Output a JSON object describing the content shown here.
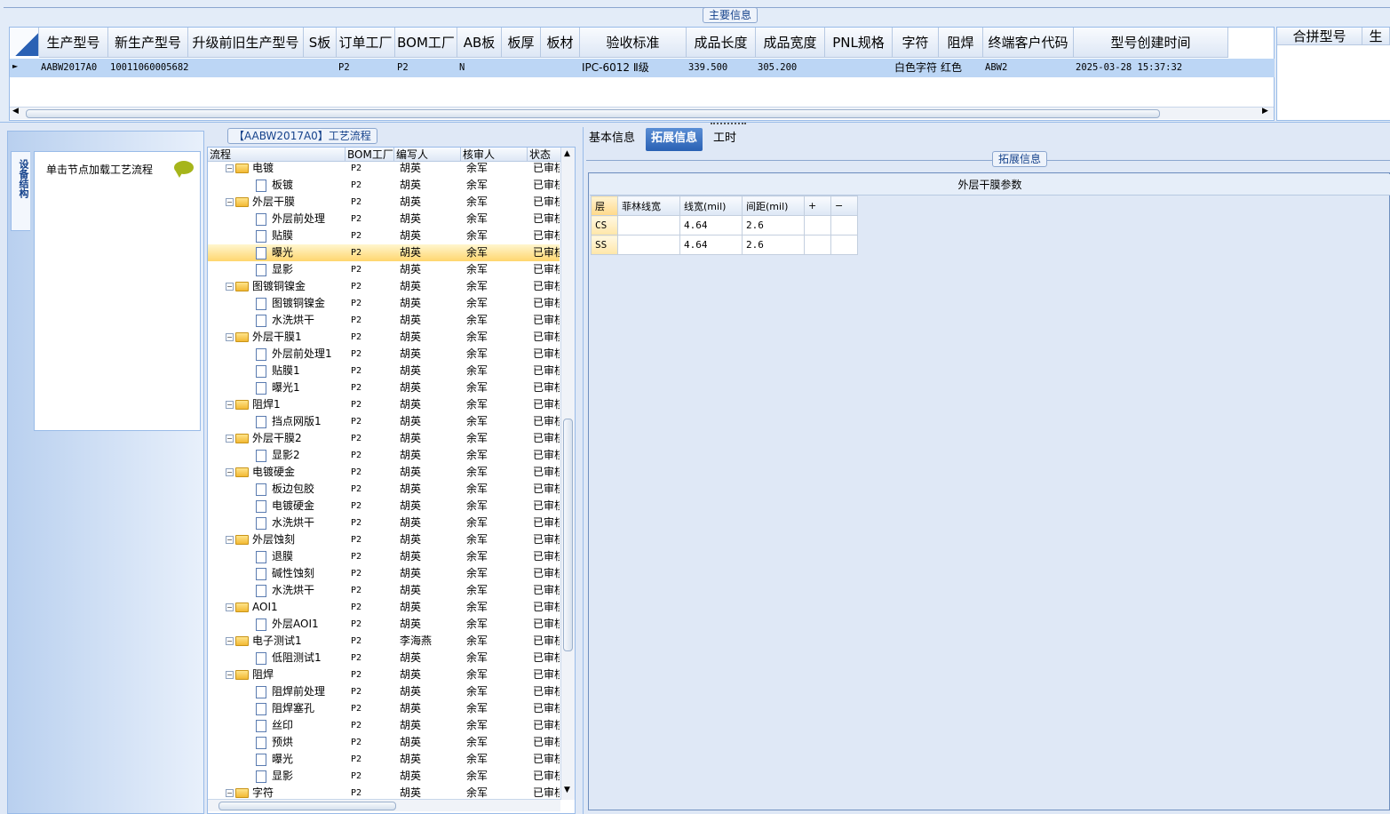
{
  "top": {
    "group_title": "主要信息",
    "columns": [
      "生产型号",
      "新生产型号",
      "升级前旧生产型号",
      "S板",
      "订单工厂",
      "BOM工厂",
      "AB板",
      "板厚",
      "板材",
      "验收标准",
      "成品长度",
      "成品宽度",
      "PNL规格",
      "字符",
      "阻焊",
      "终端客户代码",
      "型号创建时间"
    ],
    "row": [
      "AABW2017A0",
      "10011060005682",
      "",
      "",
      "P2",
      "P2",
      "N",
      "",
      "",
      "IPC-6012 Ⅱ级",
      "339.500",
      "305.200",
      "",
      "白色字符",
      "红色",
      "ABW2",
      "2025-03-28 15:37:32"
    ],
    "side_columns": [
      "合拼型号",
      "生"
    ]
  },
  "left_panel": {
    "vertical_tab": "设备结构",
    "hint_text": "单击节点加载工艺流程",
    "hint_icon": "speech-bubble-icon"
  },
  "process": {
    "group_title": "【AABW2017A0】工艺流程",
    "columns": [
      "流程",
      "BOM工厂",
      "编写人",
      "核审人",
      "状态"
    ],
    "rows": [
      {
        "name": "电镀",
        "level": 0,
        "bom": "P2",
        "writer": "胡英",
        "reviewer": "余军",
        "status": "已审核"
      },
      {
        "name": "板镀",
        "level": 1,
        "bom": "P2",
        "writer": "胡英",
        "reviewer": "余军",
        "status": "已审核"
      },
      {
        "name": "外层干膜",
        "level": 0,
        "bom": "P2",
        "writer": "胡英",
        "reviewer": "余军",
        "status": "已审核"
      },
      {
        "name": "外层前处理",
        "level": 1,
        "bom": "P2",
        "writer": "胡英",
        "reviewer": "余军",
        "status": "已审核"
      },
      {
        "name": "贴膜",
        "level": 1,
        "bom": "P2",
        "writer": "胡英",
        "reviewer": "余军",
        "status": "已审核"
      },
      {
        "name": "曝光",
        "level": 1,
        "bom": "P2",
        "writer": "胡英",
        "reviewer": "余军",
        "status": "已审核",
        "selected": true
      },
      {
        "name": "显影",
        "level": 1,
        "bom": "P2",
        "writer": "胡英",
        "reviewer": "余军",
        "status": "已审核"
      },
      {
        "name": "图镀铜镍金",
        "level": 0,
        "bom": "P2",
        "writer": "胡英",
        "reviewer": "余军",
        "status": "已审核"
      },
      {
        "name": "图镀铜镍金",
        "level": 1,
        "bom": "P2",
        "writer": "胡英",
        "reviewer": "余军",
        "status": "已审核"
      },
      {
        "name": "水洗烘干",
        "level": 1,
        "bom": "P2",
        "writer": "胡英",
        "reviewer": "余军",
        "status": "已审核"
      },
      {
        "name": "外层干膜1",
        "level": 0,
        "bom": "P2",
        "writer": "胡英",
        "reviewer": "余军",
        "status": "已审核"
      },
      {
        "name": "外层前处理1",
        "level": 1,
        "bom": "P2",
        "writer": "胡英",
        "reviewer": "余军",
        "status": "已审核"
      },
      {
        "name": "贴膜1",
        "level": 1,
        "bom": "P2",
        "writer": "胡英",
        "reviewer": "余军",
        "status": "已审核"
      },
      {
        "name": "曝光1",
        "level": 1,
        "bom": "P2",
        "writer": "胡英",
        "reviewer": "余军",
        "status": "已审核"
      },
      {
        "name": "阻焊1",
        "level": 0,
        "bom": "P2",
        "writer": "胡英",
        "reviewer": "余军",
        "status": "已审核"
      },
      {
        "name": "挡点网版1",
        "level": 1,
        "bom": "P2",
        "writer": "胡英",
        "reviewer": "余军",
        "status": "已审核"
      },
      {
        "name": "外层干膜2",
        "level": 0,
        "bom": "P2",
        "writer": "胡英",
        "reviewer": "余军",
        "status": "已审核"
      },
      {
        "name": "显影2",
        "level": 1,
        "bom": "P2",
        "writer": "胡英",
        "reviewer": "余军",
        "status": "已审核"
      },
      {
        "name": "电镀硬金",
        "level": 0,
        "bom": "P2",
        "writer": "胡英",
        "reviewer": "余军",
        "status": "已审核"
      },
      {
        "name": "板边包胶",
        "level": 1,
        "bom": "P2",
        "writer": "胡英",
        "reviewer": "余军",
        "status": "已审核"
      },
      {
        "name": "电镀硬金",
        "level": 1,
        "bom": "P2",
        "writer": "胡英",
        "reviewer": "余军",
        "status": "已审核"
      },
      {
        "name": "水洗烘干",
        "level": 1,
        "bom": "P2",
        "writer": "胡英",
        "reviewer": "余军",
        "status": "已审核"
      },
      {
        "name": "外层蚀刻",
        "level": 0,
        "bom": "P2",
        "writer": "胡英",
        "reviewer": "余军",
        "status": "已审核"
      },
      {
        "name": "退膜",
        "level": 1,
        "bom": "P2",
        "writer": "胡英",
        "reviewer": "余军",
        "status": "已审核"
      },
      {
        "name": "碱性蚀刻",
        "level": 1,
        "bom": "P2",
        "writer": "胡英",
        "reviewer": "余军",
        "status": "已审核"
      },
      {
        "name": "水洗烘干",
        "level": 1,
        "bom": "P2",
        "writer": "胡英",
        "reviewer": "余军",
        "status": "已审核"
      },
      {
        "name": "AOI1",
        "level": 0,
        "bom": "P2",
        "writer": "胡英",
        "reviewer": "余军",
        "status": "已审核"
      },
      {
        "name": "外层AOI1",
        "level": 1,
        "bom": "P2",
        "writer": "胡英",
        "reviewer": "余军",
        "status": "已审核"
      },
      {
        "name": "电子测试1",
        "level": 0,
        "bom": "P2",
        "writer": "李海燕",
        "reviewer": "余军",
        "status": "已审核"
      },
      {
        "name": "低阻测试1",
        "level": 1,
        "bom": "P2",
        "writer": "胡英",
        "reviewer": "余军",
        "status": "已审核"
      },
      {
        "name": "阻焊",
        "level": 0,
        "bom": "P2",
        "writer": "胡英",
        "reviewer": "余军",
        "status": "已审核"
      },
      {
        "name": "阻焊前处理",
        "level": 1,
        "bom": "P2",
        "writer": "胡英",
        "reviewer": "余军",
        "status": "已审核"
      },
      {
        "name": "阻焊塞孔",
        "level": 1,
        "bom": "P2",
        "writer": "胡英",
        "reviewer": "余军",
        "status": "已审核"
      },
      {
        "name": "丝印",
        "level": 1,
        "bom": "P2",
        "writer": "胡英",
        "reviewer": "余军",
        "status": "已审核"
      },
      {
        "name": "预烘",
        "level": 1,
        "bom": "P2",
        "writer": "胡英",
        "reviewer": "余军",
        "status": "已审核"
      },
      {
        "name": "曝光",
        "level": 1,
        "bom": "P2",
        "writer": "胡英",
        "reviewer": "余军",
        "status": "已审核"
      },
      {
        "name": "显影",
        "level": 1,
        "bom": "P2",
        "writer": "胡英",
        "reviewer": "余军",
        "status": "已审核"
      },
      {
        "name": "字符",
        "level": 0,
        "bom": "P2",
        "writer": "胡英",
        "reviewer": "余军",
        "status": "已审核"
      }
    ]
  },
  "right": {
    "tabs": [
      "基本信息",
      "拓展信息",
      "工时"
    ],
    "active_tab": 1,
    "group_title": "拓展信息",
    "param_title": "外层干膜参数",
    "param_columns": [
      "层",
      "菲林线宽",
      "线宽(mil)",
      "间距(mil)",
      "+",
      "−"
    ],
    "param_rows": [
      [
        "CS",
        "",
        "4.64",
        "2.6",
        "",
        ""
      ],
      [
        "SS",
        "",
        "4.64",
        "2.6",
        "",
        ""
      ]
    ]
  },
  "colors": {
    "accent": "#2a61b4",
    "selected_row": "#ffd66e",
    "header_row": "#bcd6f5"
  }
}
